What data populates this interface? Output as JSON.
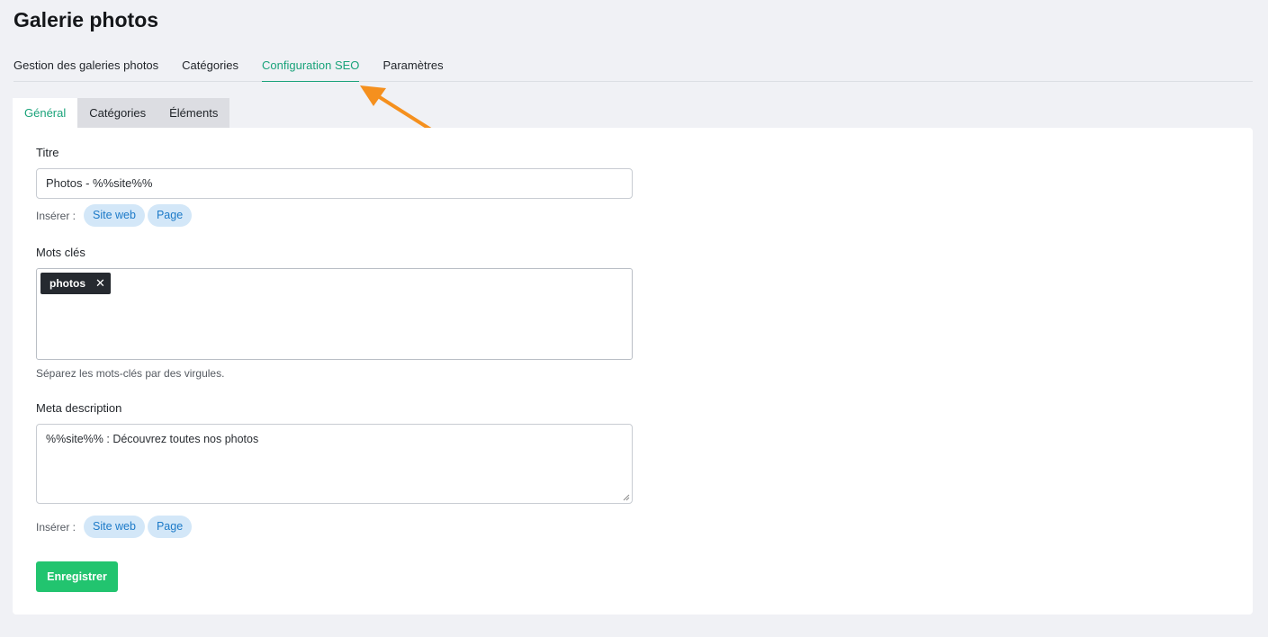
{
  "page": {
    "title": "Galerie photos"
  },
  "main_tabs": [
    {
      "label": "Gestion des galeries photos",
      "active": false
    },
    {
      "label": "Catégories",
      "active": false
    },
    {
      "label": "Configuration SEO",
      "active": true
    },
    {
      "label": "Paramètres",
      "active": false
    }
  ],
  "sub_tabs": [
    {
      "label": "Général",
      "active": true
    },
    {
      "label": "Catégories",
      "active": false
    },
    {
      "label": "Éléments",
      "active": false
    }
  ],
  "form": {
    "title": {
      "label": "Titre",
      "value": "Photos - %%site%%",
      "insert_label": "Insérer :",
      "chips": [
        "Site web",
        "Page"
      ]
    },
    "keywords": {
      "label": "Mots clés",
      "tags": [
        "photos"
      ],
      "remove_symbol": "✕",
      "help": "Séparez les mots-clés par des virgules."
    },
    "meta_description": {
      "label": "Meta description",
      "value": "%%site%% : Découvrez toutes nos photos",
      "insert_label": "Insérer :",
      "chips": [
        "Site web",
        "Page"
      ]
    },
    "save_label": "Enregistrer"
  },
  "colors": {
    "accent": "#1aa37a",
    "annotation_arrow": "#f5901e",
    "save_button": "#22c46f",
    "chip_bg": "#d3e7f8",
    "chip_text": "#1c7ac8"
  },
  "icons": {
    "annotation": "arrow-pointer-icon",
    "tag_remove": "close-icon",
    "resize": "resize-grip-icon"
  }
}
